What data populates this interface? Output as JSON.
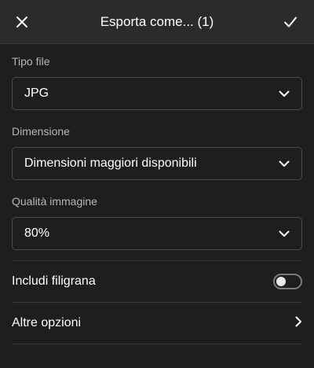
{
  "header": {
    "title": "Esporta come... (1)",
    "close_icon": "close-icon",
    "confirm_icon": "checkmark-icon"
  },
  "file_type": {
    "label": "Tipo file",
    "value": "JPG"
  },
  "dimension": {
    "label": "Dimensione",
    "value": "Dimensioni maggiori disponibili"
  },
  "quality": {
    "label": "Qualità immagine",
    "value": "80%"
  },
  "watermark": {
    "label": "Includi filigrana",
    "enabled": false
  },
  "more_options": {
    "label": "Altre opzioni"
  },
  "colors": {
    "background": "#1e1e1e",
    "header": "#2b2b2b",
    "border": "#4a4a4a",
    "label_text": "#b6b6b6"
  }
}
